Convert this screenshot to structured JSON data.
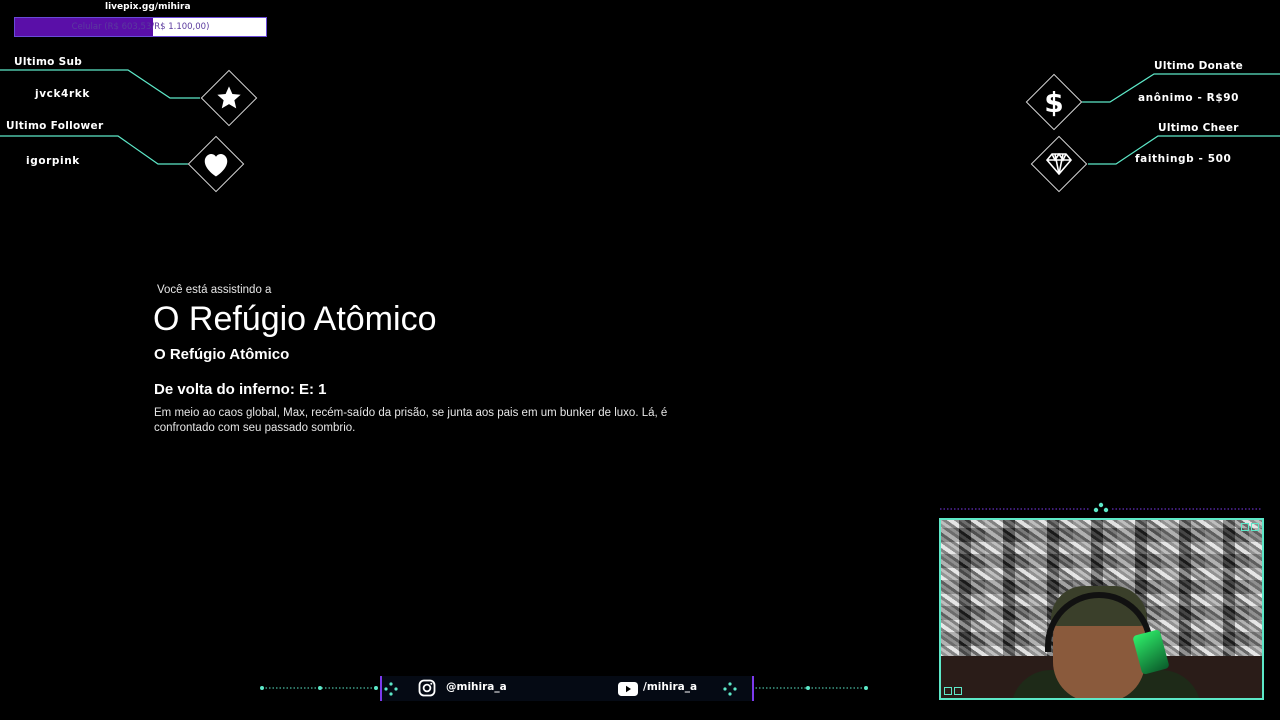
{
  "goal": {
    "url": "livepix.gg/mihira",
    "text": "Celular (R$ 603,53/R$ 1.100,00)",
    "progress": 0.55,
    "fill_color": "#5a0fa8"
  },
  "widgets": {
    "last_sub": {
      "label": "Ultimo Sub",
      "value": "jvck4rkk",
      "icon": "star-icon"
    },
    "last_follower": {
      "label": "Ultimo Follower",
      "value": "igorpink",
      "icon": "heart-icon"
    },
    "last_donate": {
      "label": "Ultimo Donate",
      "value": "anônimo - R$90",
      "icon": "dollar-icon"
    },
    "last_cheer": {
      "label": "Ultimo Cheer",
      "value": "faithingb - 500",
      "icon": "diamond-gem-icon"
    },
    "line_color": "#5de8c8"
  },
  "info": {
    "watching_label": "Você está assistindo a",
    "title": "O Refúgio Atômico",
    "subtitle": "O Refúgio Atômico",
    "episode": "De volta do inferno: E: 1",
    "description": "Em meio ao caos global, Max, recém-saído da prisão, se junta aos pais em um bunker de luxo. Lá, é confrontado com seu passado sombrio."
  },
  "social": {
    "instagram": "@mihira_a",
    "youtube": "/mihira_a",
    "accent": "#7c3aed"
  },
  "webcam": {
    "border_color": "#5de8c8"
  }
}
